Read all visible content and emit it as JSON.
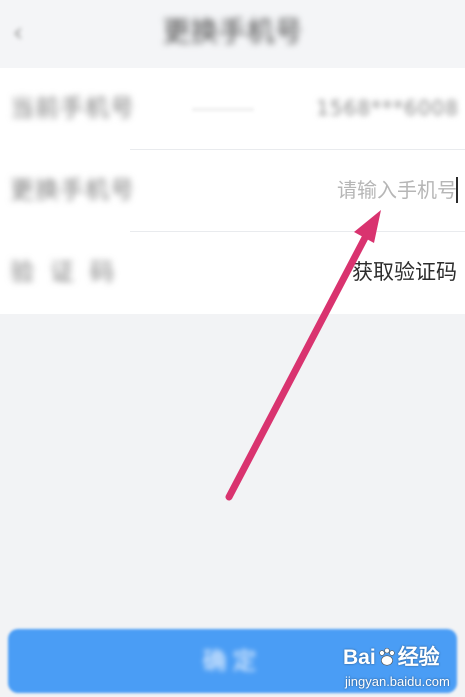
{
  "header": {
    "back_icon": "chevron-left-icon",
    "back_glyph": "‹",
    "title": "更换手机号"
  },
  "form": {
    "current_phone": {
      "label": "当前手机号",
      "value": "1568***6008"
    },
    "new_phone": {
      "label": "更换手机号",
      "placeholder": "请输入手机号",
      "value": ""
    },
    "verification": {
      "label": "验证码",
      "action_label": "获取验证码"
    }
  },
  "footer": {
    "confirm_label": "确定"
  },
  "annotation": {
    "type": "arrow",
    "color": "#d9336f",
    "points_to": "new-phone-input"
  },
  "watermark": {
    "logo_left": "Bai",
    "logo_icon": "paw-icon",
    "logo_right": "经验",
    "url": "jingyan.baidu.com"
  },
  "colors": {
    "accent": "#4a9df5",
    "background": "#f2f3f5",
    "arrow": "#d9336f"
  }
}
